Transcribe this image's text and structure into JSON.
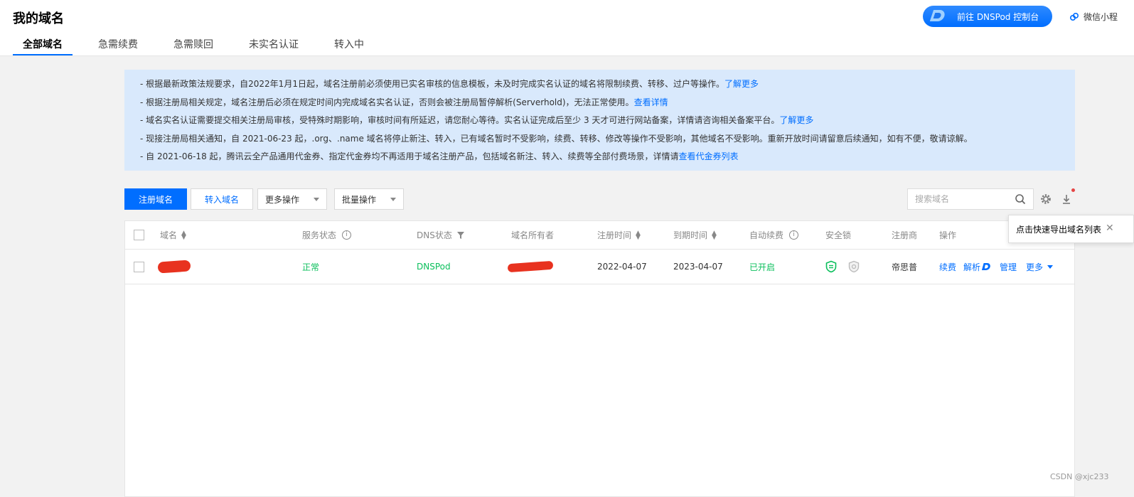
{
  "header": {
    "title": "我的域名",
    "tabs": [
      "全部域名",
      "急需续费",
      "急需赎回",
      "未实名认证",
      "转入中"
    ],
    "dnspod_button": "前往 DNSPod 控制台",
    "wechat_label": "微信小程"
  },
  "notice": {
    "lines": [
      {
        "text": "- 根据最新政策法规要求，自2022年1月1日起，域名注册前必须使用已实名审核的信息模板，未及时完成实名认证的域名将限制续费、转移、过户等操作。",
        "link": "了解更多"
      },
      {
        "text": "- 根据注册局相关规定，域名注册后必须在规定时间内完成域名实名认证，否则会被注册局暂停解析(Serverhold)，无法正常使用。",
        "link": "查看详情"
      },
      {
        "text": "- 域名实名认证需要提交相关注册局审核，受特殊时期影响，审核时间有所延迟，请您耐心等待。实名认证完成后至少 3 天才可进行网站备案，详情请咨询相关备案平台。",
        "link": "了解更多"
      },
      {
        "text": "- 现接注册局相关通知，自 2021-06-23 起，.org、.name 域名将停止新注、转入，已有域名暂时不受影响，续费、转移、修改等操作不受影响，其他域名不受影响。重新开放时间请留意后续通知，如有不便，敬请谅解。",
        "link": ""
      },
      {
        "text": "- 自 2021-06-18 起，腾讯云全产品通用代金券、指定代金券均不再适用于域名注册产品，包括域名新注、转入、续费等全部付费场景，详情请",
        "link": "查看代金券列表"
      }
    ]
  },
  "toolbar": {
    "register": "注册域名",
    "transfer_in": "转入域名",
    "more_ops": "更多操作",
    "batch_ops": "批量操作",
    "search_placeholder": "搜索域名"
  },
  "tooltip": "点击快速导出域名列表",
  "table": {
    "columns": {
      "domain": "域名",
      "service_status": "服务状态",
      "dns_status": "DNS状态",
      "owner": "域名所有者",
      "reg_time": "注册时间",
      "expire_time": "到期时间",
      "auto_renew": "自动续费",
      "security_lock": "安全锁",
      "registrar": "注册商",
      "actions": "操作"
    },
    "rows": [
      {
        "service_status": "正常",
        "dns_status": "DNSPod",
        "reg_time": "2022-04-07",
        "expire_time": "2023-04-07",
        "auto_renew": "已开启",
        "registrar": "帝思普",
        "actions": {
          "renew": "续费",
          "resolve": "解析",
          "manage": "管理",
          "more": "更多"
        }
      }
    ]
  },
  "watermark": "CSDN @xjc233",
  "colors": {
    "accent": "#006eff",
    "notice_bg": "#d9e9fc",
    "success": "#0abf5b",
    "redaction": "#e8321f"
  }
}
